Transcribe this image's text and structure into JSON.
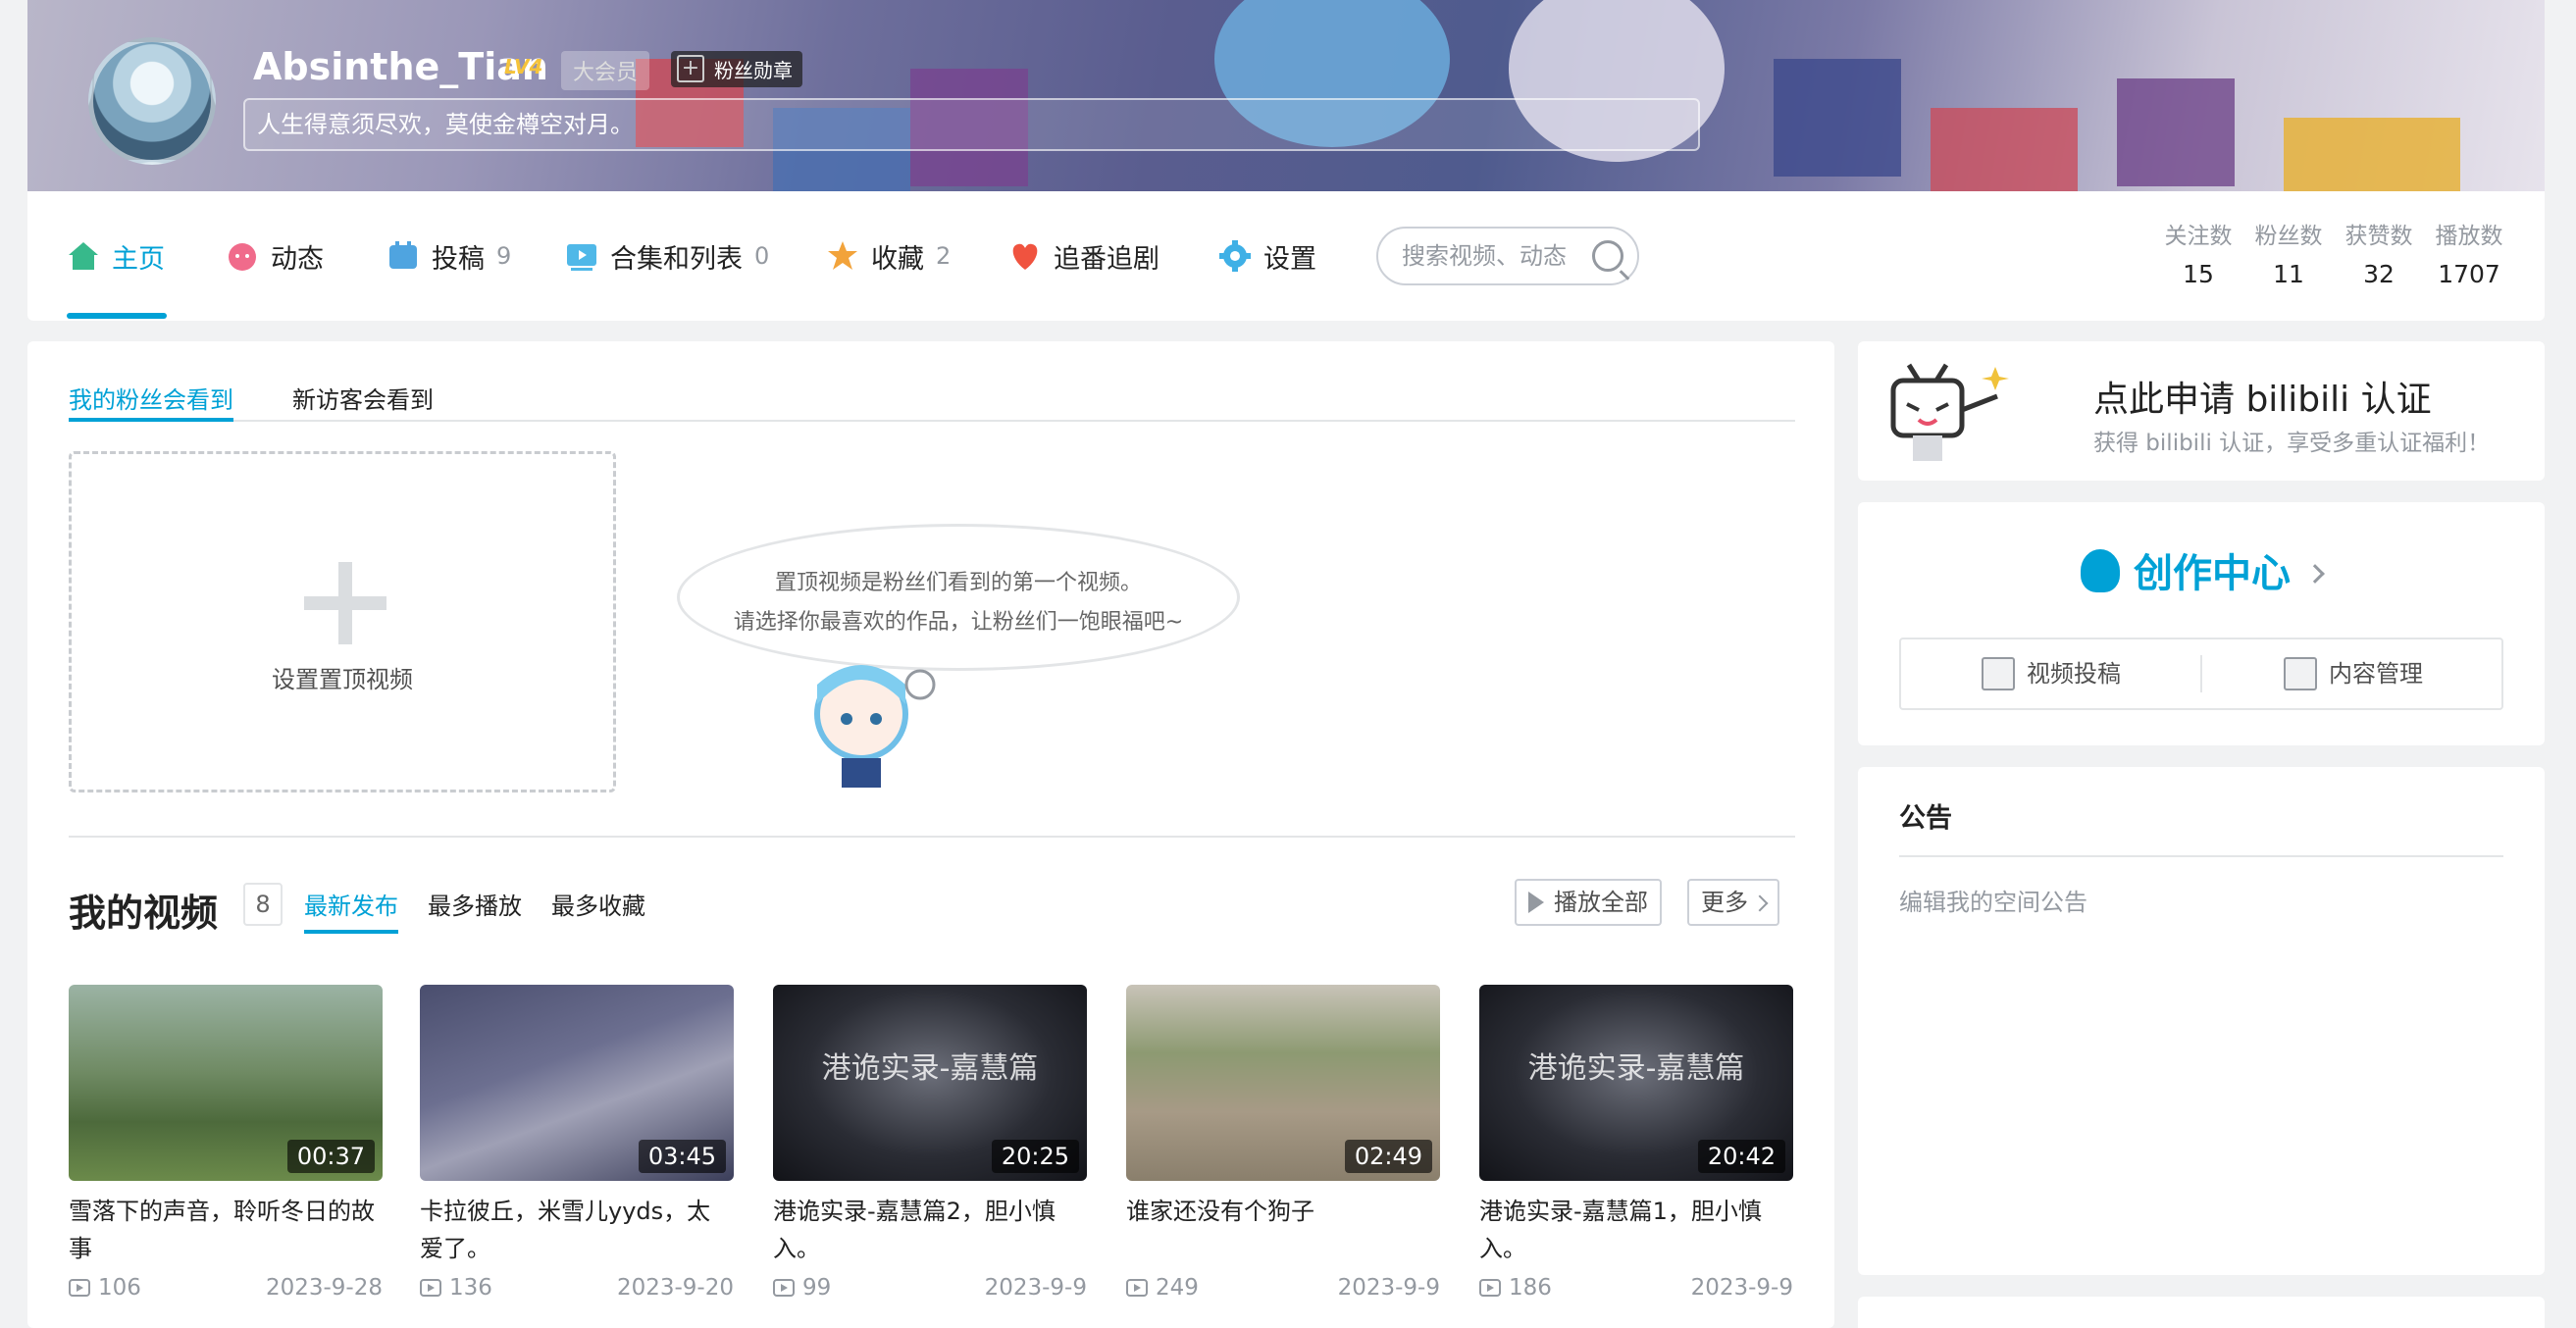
{
  "profile": {
    "username": "Absinthe_Tian",
    "level": "LV4",
    "vip_label": "大会员",
    "medal_label": "粉丝勋章",
    "sign": "人生得意须尽欢，莫使金樽空对月。"
  },
  "nav": {
    "items": [
      {
        "label": "主页",
        "count": ""
      },
      {
        "label": "动态",
        "count": ""
      },
      {
        "label": "投稿",
        "count": "9"
      },
      {
        "label": "合集和列表",
        "count": "0"
      },
      {
        "label": "收藏",
        "count": "2"
      },
      {
        "label": "追番追剧",
        "count": ""
      },
      {
        "label": "设置",
        "count": ""
      }
    ],
    "search_placeholder": "搜索视频、动态",
    "stats": [
      {
        "label": "关注数",
        "value": "15"
      },
      {
        "label": "粉丝数",
        "value": "11"
      },
      {
        "label": "获赞数",
        "value": "32"
      },
      {
        "label": "播放数",
        "value": "1707"
      }
    ]
  },
  "pinned": {
    "tabs": [
      "我的粉丝会看到",
      "新访客会看到"
    ],
    "set_label": "设置置顶视频",
    "tip_line1": "置顶视频是粉丝们看到的第一个视频。",
    "tip_line2": "请选择你最喜欢的作品，让粉丝们一饱眼福吧~"
  },
  "videos": {
    "heading": "我的视频",
    "count": "8",
    "tabs": [
      "最新发布",
      "最多播放",
      "最多收藏"
    ],
    "play_all": "播放全部",
    "more": "更多",
    "list": [
      {
        "title": "雪落下的声音，聆听冬日的故事",
        "duration": "00:37",
        "plays": "106",
        "date": "2023-9-28",
        "caption": ""
      },
      {
        "title": "卡拉彼丘，米雪儿yyds，太爱了。",
        "duration": "03:45",
        "plays": "136",
        "date": "2023-9-20",
        "caption": ""
      },
      {
        "title": "港诡实录-嘉慧篇2，胆小慎入。",
        "duration": "20:25",
        "plays": "99",
        "date": "2023-9-9",
        "caption": "港诡实录-嘉慧篇"
      },
      {
        "title": "谁家还没有个狗子",
        "duration": "02:49",
        "plays": "249",
        "date": "2023-9-9",
        "caption": ""
      },
      {
        "title": "港诡实录-嘉慧篇1，胆小慎入。",
        "duration": "20:42",
        "plays": "186",
        "date": "2023-9-9",
        "caption": "港诡实录-嘉慧篇"
      }
    ]
  },
  "sidebar": {
    "cert_title": "点此申请 bilibili 认证",
    "cert_sub": "获得 bilibili 认证，享受多重认证福利！",
    "creator_title": "创作中心",
    "upload_label": "视频投稿",
    "manage_label": "内容管理",
    "notice_title": "公告",
    "notice_edit": "编辑我的空间公告"
  },
  "colors": {
    "accent": "#00a1d6",
    "bg": "#f1f2f3"
  }
}
